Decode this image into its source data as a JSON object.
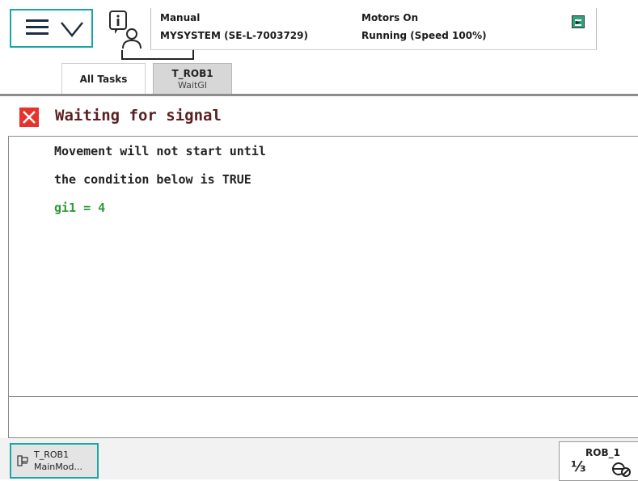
{
  "header": {
    "mode": "Manual",
    "system": "MYSYSTEM (SE-L-7003729)",
    "motors": "Motors On",
    "running": "Running (Speed 100%)"
  },
  "icons": {
    "menu": "hamburger-menu-icon",
    "menu_chevron": "chevron-down-icon",
    "info": "event-info-icon",
    "status": "status-icon",
    "error": "close-error-icon",
    "task": "program-module-icon",
    "robot": "jog-robot-icon"
  },
  "tabs": [
    {
      "title": "All Tasks",
      "subtitle": ""
    },
    {
      "title": "T_ROB1",
      "subtitle": "WaitGI"
    }
  ],
  "dialog": {
    "title": "Waiting for signal",
    "line1": "Movement will not start until",
    "line2": "the condition below is TRUE",
    "condition": "gi1 = 4"
  },
  "taskbar": {
    "task_line1": "T_ROB1",
    "task_line2": "MainMod...",
    "robot_label": "ROB_1",
    "fraction": "⅓"
  },
  "colors": {
    "accent": "#1aa6a6",
    "error": "#e8322b",
    "condition": "#2e9a3a",
    "title": "#5a1f1f"
  }
}
